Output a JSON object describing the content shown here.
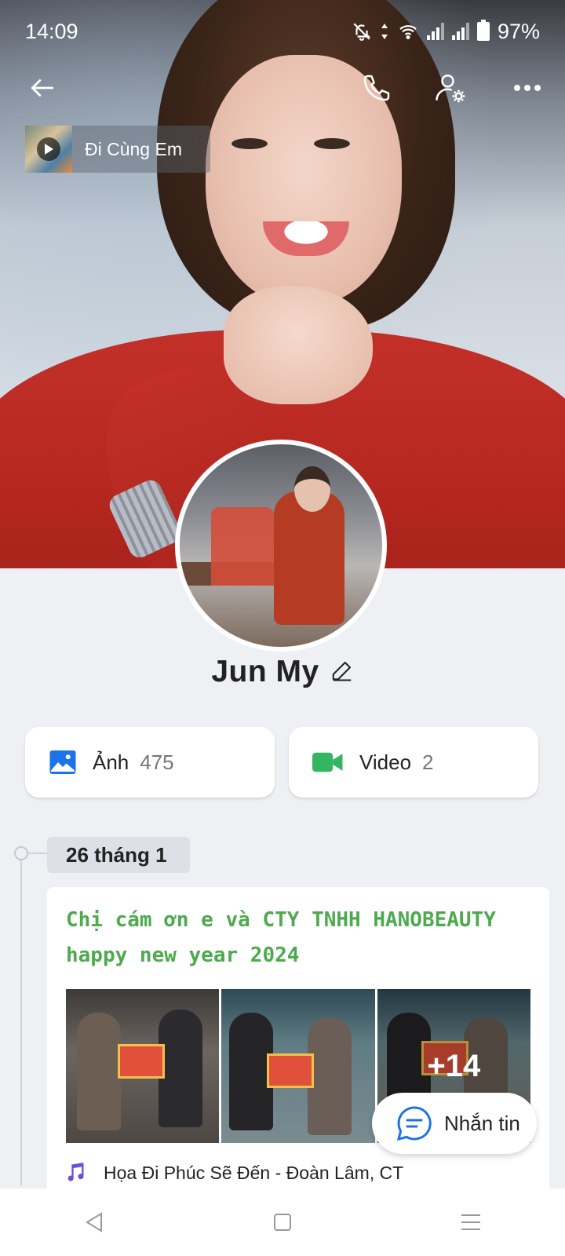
{
  "status_bar": {
    "time": "14:09",
    "battery": "97%"
  },
  "music": {
    "song_title": "Đi Cùng Em"
  },
  "profile": {
    "name": "Jun My"
  },
  "media": {
    "photos_label": "Ảnh",
    "photos_count": "475",
    "videos_label": "Video",
    "videos_count": "2"
  },
  "timeline": {
    "date": "26 tháng 1",
    "post": {
      "text": "Chị cám ơn e và CTY TNHH HANOBEAUTY happy new year 2024",
      "more_photos": "+14",
      "song": "Họa Đi Phúc Sẽ Đến - Đoàn Lâm, CT"
    }
  },
  "actions": {
    "message_label": "Nhắn tin"
  },
  "icons": {
    "back": "back-arrow-icon",
    "call": "phone-icon",
    "settings": "user-settings-icon",
    "more": "more-dots-icon",
    "edit": "pencil-icon",
    "photos": "image-icon",
    "videos": "video-camera-icon",
    "message": "chat-bubble-icon",
    "music": "music-note-icon"
  },
  "colors": {
    "accent_blue": "#1a73e8",
    "video_green": "#34b561",
    "post_text_green": "#4daa4d",
    "music_purple": "#6b4fd8"
  }
}
